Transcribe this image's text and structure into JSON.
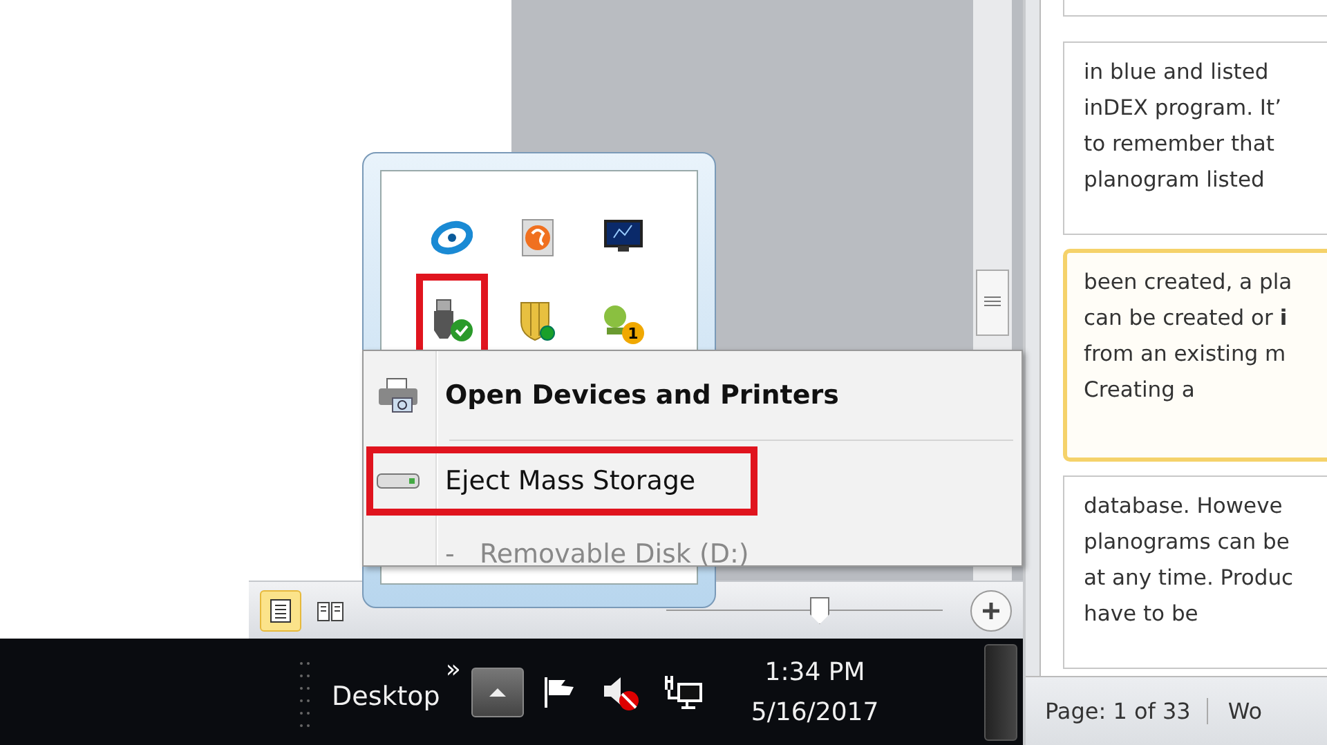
{
  "tray_overflow": {
    "icons": [
      {
        "kind": "sync"
      },
      {
        "kind": "swirl"
      },
      {
        "kind": "monitor"
      },
      {
        "kind": "usb",
        "highlighted": true
      },
      {
        "kind": "shield",
        "highlighted": false
      },
      {
        "kind": "update",
        "highlighted": false,
        "badge": "1"
      }
    ]
  },
  "context_menu": {
    "items": [
      {
        "kind": "command",
        "label": "Open Devices and Printers",
        "default": true,
        "highlighted": false
      },
      {
        "kind": "separator"
      },
      {
        "kind": "command",
        "label": "Eject Mass Storage",
        "default": false,
        "highlighted": true
      },
      {
        "kind": "subitem",
        "label": "-   Removable Disk (D:)",
        "disabled": true
      }
    ]
  },
  "word_status_bar": {
    "views": [
      {
        "kind": "print",
        "selected": true
      },
      {
        "kind": "reading",
        "selected": false
      }
    ],
    "zoom_slider": {
      "level": 0.55
    }
  },
  "taskbar": {
    "toolbar_label": "Desktop",
    "chevron": "»",
    "time": "1:34 PM",
    "date": "5/16/2017"
  },
  "comments": [
    {
      "selected": false
    },
    {
      "lines": [
        "in blue and listed",
        "inDEX program. It’",
        "to remember that",
        "planogram listed"
      ],
      "selected": false
    },
    {
      "lines": [
        "been created, a pla",
        "can be created or **i**",
        "from an existing m",
        "Creating a"
      ],
      "selected": true
    },
    {
      "lines": [
        "database. Howeve",
        "planograms can be",
        "at any time. Produc",
        "have to be"
      ],
      "selected": false
    }
  ],
  "doc_status_bar": {
    "page": "Page: 1 of 33",
    "words": "Wo"
  }
}
